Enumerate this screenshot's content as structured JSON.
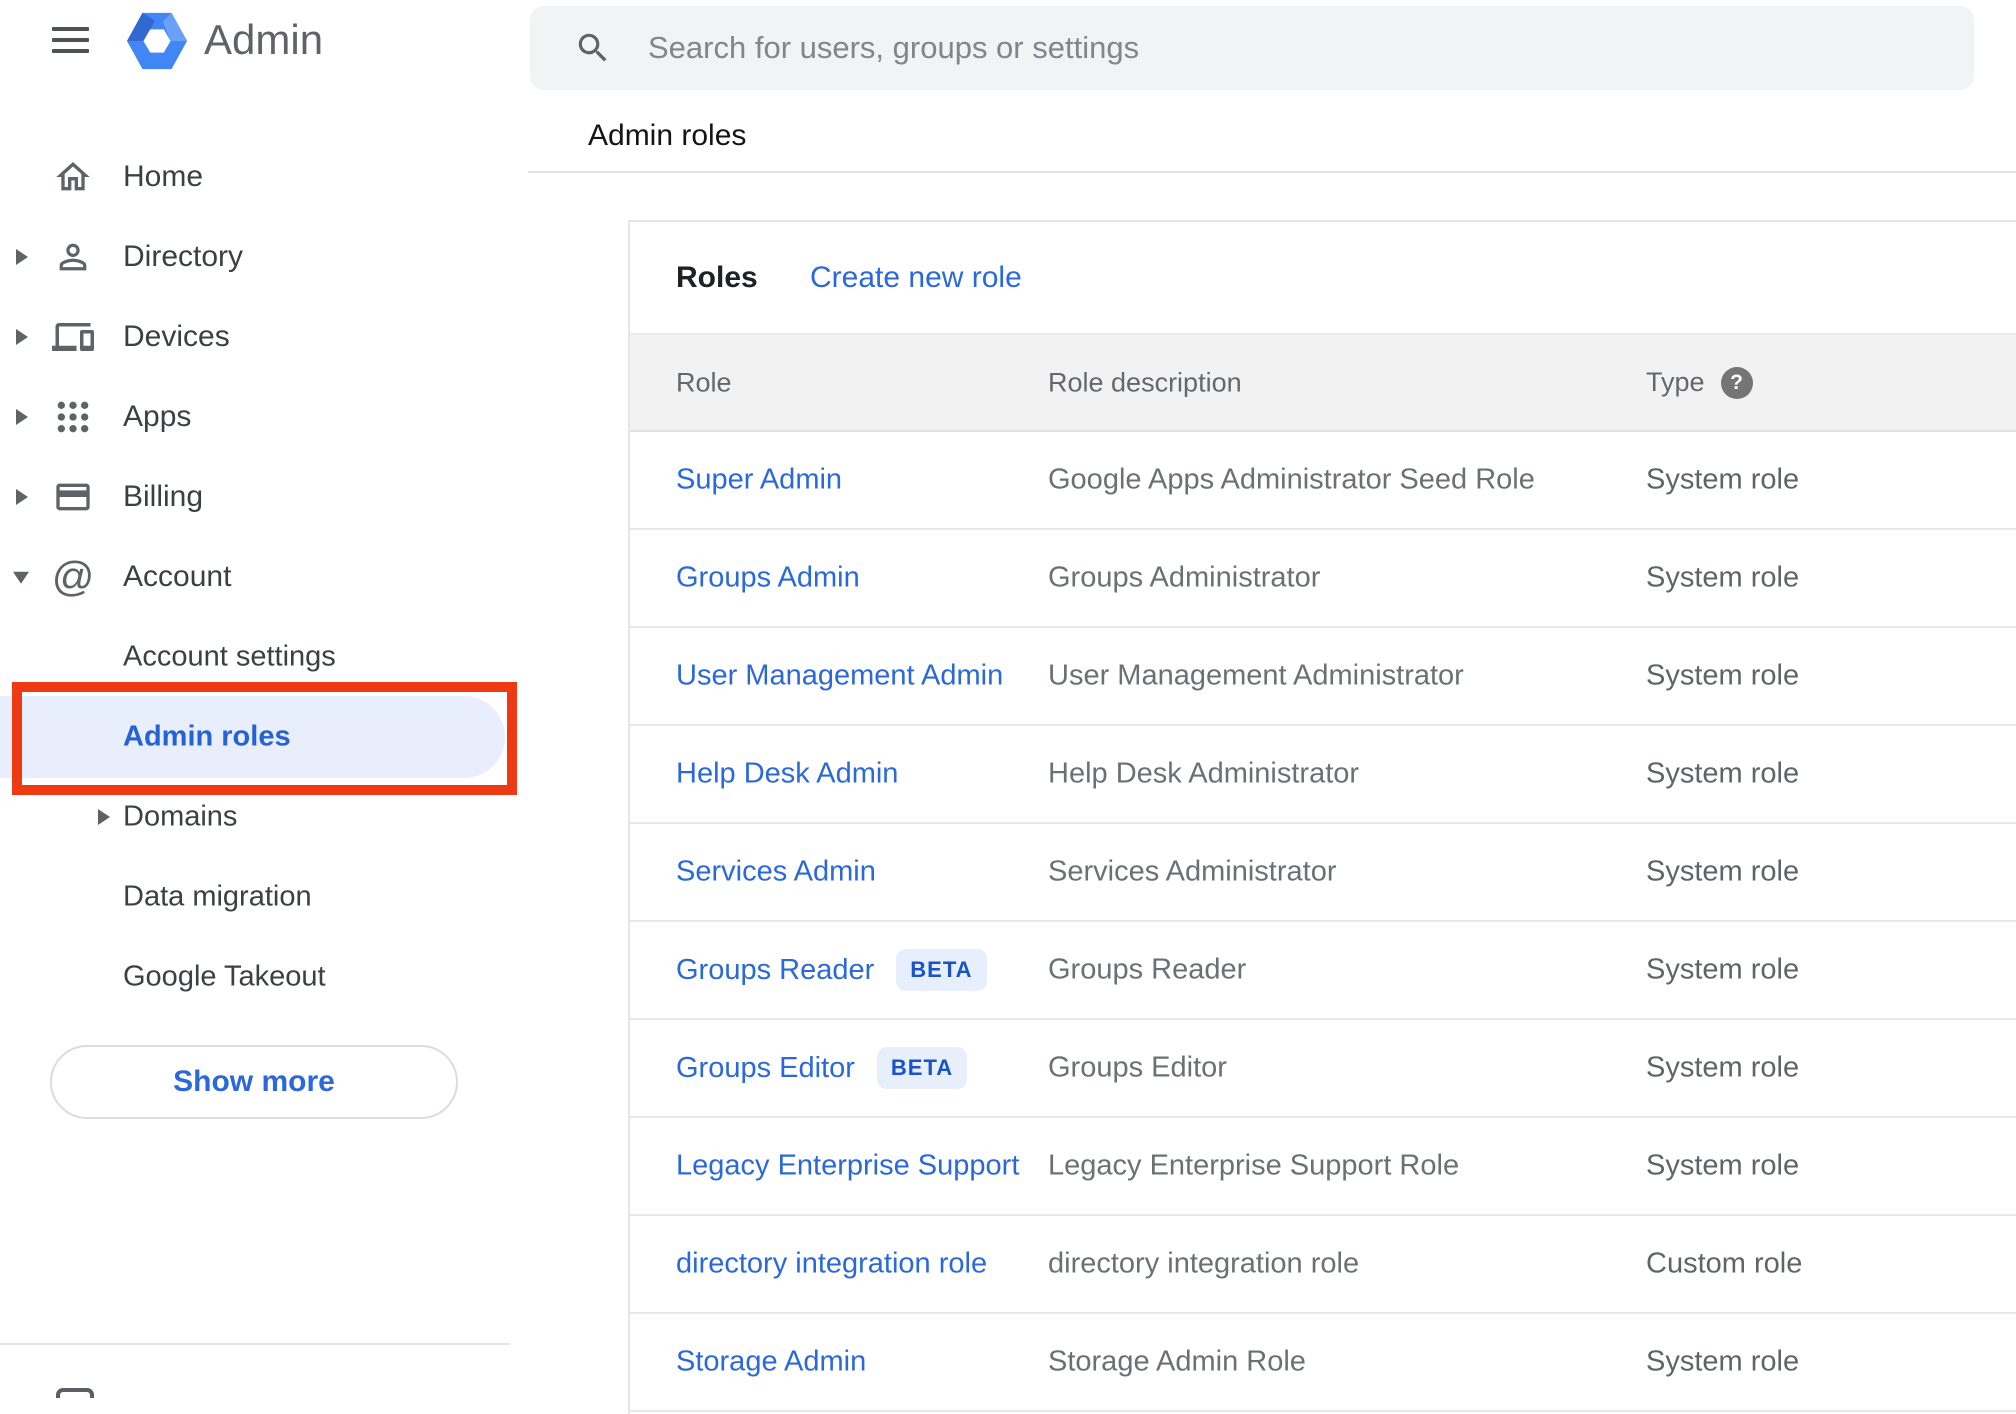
{
  "app": {
    "title": "Admin"
  },
  "search": {
    "placeholder": "Search for users, groups or settings"
  },
  "breadcrumb": "Admin roles",
  "sidebar": {
    "items": [
      {
        "label": "Home",
        "icon": "home",
        "expandable": false,
        "expanded": false
      },
      {
        "label": "Directory",
        "icon": "person",
        "expandable": true,
        "expanded": false
      },
      {
        "label": "Devices",
        "icon": "devices",
        "expandable": true,
        "expanded": false
      },
      {
        "label": "Apps",
        "icon": "apps",
        "expandable": true,
        "expanded": false
      },
      {
        "label": "Billing",
        "icon": "credit-card",
        "expandable": true,
        "expanded": false
      },
      {
        "label": "Account",
        "icon": "at-sign",
        "expandable": true,
        "expanded": true
      }
    ],
    "account_children": [
      {
        "label": "Account settings",
        "expandable": false,
        "selected": false
      },
      {
        "label": "Admin roles",
        "expandable": false,
        "selected": true
      },
      {
        "label": "Domains",
        "expandable": true,
        "selected": false
      },
      {
        "label": "Data migration",
        "expandable": false,
        "selected": false
      },
      {
        "label": "Google Takeout",
        "expandable": false,
        "selected": false
      }
    ],
    "show_more_label": "Show more"
  },
  "main": {
    "card_title": "Roles",
    "create_link": "Create new role",
    "help_glyph": "?",
    "table": {
      "headers": [
        "Role",
        "Role description",
        "Type"
      ],
      "rows": [
        {
          "role": "Super Admin",
          "beta": false,
          "description": "Google Apps Administrator Seed Role",
          "type": "System role"
        },
        {
          "role": "Groups Admin",
          "beta": false,
          "description": "Groups Administrator",
          "type": "System role"
        },
        {
          "role": "User Management Admin",
          "beta": false,
          "description": "User Management Administrator",
          "type": "System role"
        },
        {
          "role": "Help Desk Admin",
          "beta": false,
          "description": "Help Desk Administrator",
          "type": "System role"
        },
        {
          "role": "Services Admin",
          "beta": false,
          "description": "Services Administrator",
          "type": "System role"
        },
        {
          "role": "Groups Reader",
          "beta": true,
          "description": "Groups Reader",
          "type": "System role"
        },
        {
          "role": "Groups Editor",
          "beta": true,
          "description": "Groups Editor",
          "type": "System role"
        },
        {
          "role": "Legacy Enterprise Support",
          "beta": false,
          "description": "Legacy Enterprise Support Role",
          "type": "System role"
        },
        {
          "role": "directory integration role",
          "beta": false,
          "description": "directory integration role",
          "type": "Custom role"
        },
        {
          "role": "Storage Admin",
          "beta": false,
          "description": "Storage Admin Role",
          "type": "System role"
        }
      ],
      "beta_badge_label": "BETA"
    }
  },
  "colors": {
    "link_blue": "#2b68d9",
    "selected_blue": "#2563d4",
    "selected_pill_bg": "#e9eefc",
    "annotation_red": "#ee3a12",
    "beta_bg": "#e7effd",
    "beta_text": "#1a53c4",
    "header_band_bg": "#f2f2f2",
    "search_bg": "#f1f3f4",
    "logo_blue": "#4285f4"
  }
}
